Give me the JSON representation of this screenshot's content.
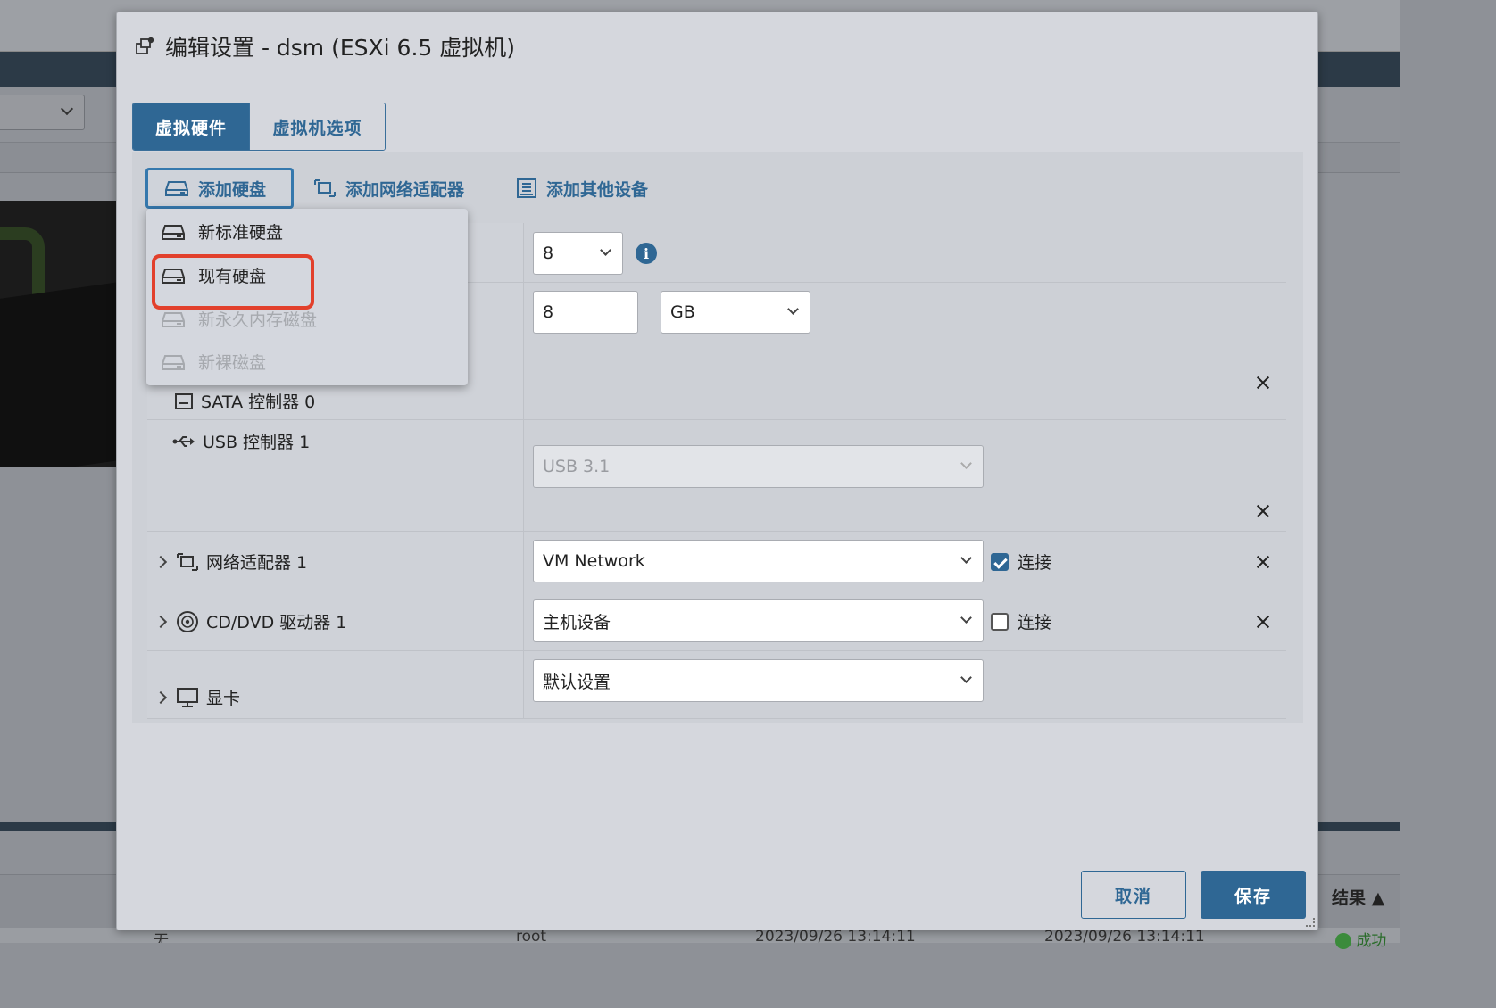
{
  "dialog": {
    "title": "编辑设置 - dsm (ESXi 6.5 虚拟机)",
    "tabs": [
      {
        "label": "虚拟硬件",
        "active": true
      },
      {
        "label": "虚拟机选项",
        "active": false
      }
    ],
    "add_bar": {
      "add_disk": "添加硬盘",
      "add_network": "添加网络适配器",
      "add_other": "添加其他设备"
    },
    "add_disk_menu": [
      {
        "label": "新标准硬盘",
        "enabled": true
      },
      {
        "label": "现有硬盘",
        "enabled": true,
        "highlighted": true
      },
      {
        "label": "新永久内存磁盘",
        "enabled": false
      },
      {
        "label": "新裸磁盘",
        "enabled": false
      }
    ],
    "hardware": {
      "cpu_value": "8",
      "memory_value": "8",
      "memory_unit": "GB",
      "sata_label": "SATA 控制器 0",
      "usb_label": "USB 控制器 1",
      "usb_type": "USB 3.1",
      "network_label": "网络适配器 1",
      "network_value": "VM Network",
      "network_connect_label": "连接",
      "network_connected": true,
      "cddvd_label": "CD/DVD 驱动器 1",
      "cddvd_value": "主机设备",
      "cddvd_connect_label": "连接",
      "cddvd_connected": false,
      "display_label": "显卡",
      "display_value": "默认设置"
    },
    "footer": {
      "cancel": "取消",
      "save": "保存"
    }
  },
  "background": {
    "table_result_header": "结果 ▲",
    "row": {
      "col1": "无",
      "col2": "root",
      "col3": "2023/09/26 13:14:11",
      "col4": "2023/09/26 13:14:11",
      "result": "成功"
    }
  },
  "colors": {
    "accent": "#2f6794",
    "highlight": "#e2402c",
    "dialog_bg": "#d5d7dd"
  }
}
